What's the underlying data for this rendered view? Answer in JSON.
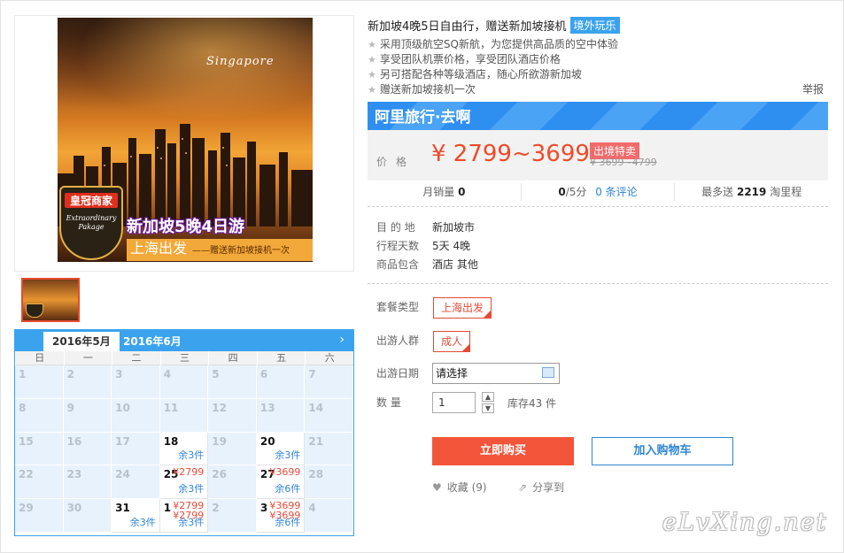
{
  "product": {
    "title": "新加坡4晚5日自由行，赠送新加坡接机",
    "tag": "境外玩乐",
    "features": [
      "采用顶级航空SQ新航，为您提供高品质的空中体验",
      "享受团队机票价格，享受团队酒店价格",
      "另可搭配各种等级酒店，随心所欲游新加坡",
      "赠送新加坡接机一次"
    ],
    "report": "举报"
  },
  "hero": {
    "city_text": "Singapore",
    "badge_title": "皇冠商家",
    "badge_sub": "Extraordinary Pakage",
    "headline": "新加坡5晚4日游",
    "depart": "上海出发",
    "gift": "——赠送新加坡接机一次"
  },
  "banner": {
    "text": "阿里旅行·去啊"
  },
  "price": {
    "label": "价格",
    "value": "¥ 2799~3699",
    "special_tag": "出境特卖",
    "original": "¥ 3699~4799"
  },
  "stats": {
    "monthly_label": "月销量",
    "monthly_value": "0",
    "score_value": "0",
    "score_unit": "/5分",
    "reviews": "0 条评论",
    "miles_prefix": "最多送",
    "miles_value": "2219",
    "miles_suffix": "淘里程"
  },
  "info": [
    {
      "key": "目 的 地",
      "value": "新加坡市"
    },
    {
      "key": "行程天数",
      "value": "5天 4晚"
    },
    {
      "key": "商品包含",
      "value": "酒店  其他"
    }
  ],
  "options": {
    "package_label": "套餐类型",
    "package_value": "上海出发",
    "crowd_label": "出游人群",
    "crowd_value": "成人",
    "date_label": "出游日期",
    "date_placeholder": "请选择",
    "qty_label": "数    量",
    "qty_value": "1",
    "stock": "库存43 件"
  },
  "actions": {
    "buy": "立即购买",
    "cart": "加入购物车",
    "favorite": "收藏 (9)",
    "share": "分享到"
  },
  "calendar": {
    "tab_current": "2016年5月",
    "tab_next": "2016年6月",
    "arrow": "›",
    "weekdays": [
      "日",
      "一",
      "二",
      "三",
      "四",
      "五",
      "六"
    ],
    "cells": [
      {
        "d": "1"
      },
      {
        "d": "2"
      },
      {
        "d": "3"
      },
      {
        "d": "4"
      },
      {
        "d": "5"
      },
      {
        "d": "6"
      },
      {
        "d": "7"
      },
      {
        "d": "8"
      },
      {
        "d": "9"
      },
      {
        "d": "10"
      },
      {
        "d": "11"
      },
      {
        "d": "12"
      },
      {
        "d": "13"
      },
      {
        "d": "14"
      },
      {
        "d": "15"
      },
      {
        "d": "16"
      },
      {
        "d": "17"
      },
      {
        "d": "18",
        "avail": true,
        "s": "余3件"
      },
      {
        "d": "19"
      },
      {
        "d": "20",
        "avail": true,
        "s": "余3件"
      },
      {
        "d": "21"
      },
      {
        "d": "22"
      },
      {
        "d": "23"
      },
      {
        "d": "24"
      },
      {
        "d": "25",
        "avail": true,
        "p": "¥2799",
        "s": "余3件"
      },
      {
        "d": "26"
      },
      {
        "d": "27",
        "avail": true,
        "p": "¥3699",
        "s": "余6件"
      },
      {
        "d": "28"
      },
      {
        "d": "29"
      },
      {
        "d": "30"
      },
      {
        "d": "31",
        "avail": true,
        "s": "余3件"
      },
      {
        "d": "1",
        "avail": true,
        "p": "¥2799",
        "p2": "¥2799",
        "s": "余3件"
      },
      {
        "d": "2"
      },
      {
        "d": "3",
        "avail": true,
        "p": "¥3699",
        "p2": "¥3699",
        "s": "余6件"
      },
      {
        "d": "4"
      }
    ]
  },
  "watermark": "eLvXing.net",
  "colors": {
    "accent": "#3ba3ee",
    "price": "#f04a2a",
    "buy": "#f3553a",
    "link": "#2f86d3"
  }
}
